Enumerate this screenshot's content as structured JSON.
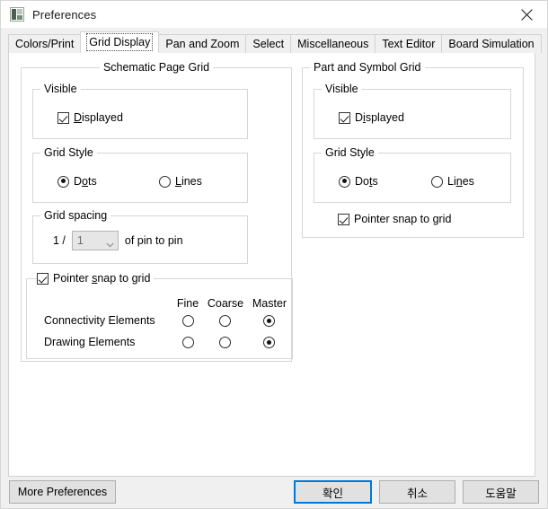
{
  "window": {
    "title": "Preferences",
    "icon": "app-icon",
    "close_icon": "close-icon"
  },
  "tabs": [
    {
      "label": "Colors/Print",
      "active": false
    },
    {
      "label": "Grid Display",
      "active": true
    },
    {
      "label": "Pan and Zoom",
      "active": false
    },
    {
      "label": "Select",
      "active": false
    },
    {
      "label": "Miscellaneous",
      "active": false
    },
    {
      "label": "Text Editor",
      "active": false
    },
    {
      "label": "Board Simulation",
      "active": false
    }
  ],
  "schematic_page_grid": {
    "legend": "Schematic Page Grid",
    "visible": {
      "legend": "Visible",
      "displayed": {
        "label_pre": "",
        "label_acc": "D",
        "label_post": "isplayed",
        "checked": true
      }
    },
    "grid_style": {
      "legend": "Grid Style",
      "dots": {
        "pre": "D",
        "acc": "o",
        "post": "ts",
        "selected": true
      },
      "lines": {
        "pre": "",
        "acc": "L",
        "post": "ines",
        "selected": false
      }
    },
    "grid_spacing": {
      "legend": "Grid spacing",
      "prefix": "1 /",
      "value": "1",
      "suffix": "of pin to pin",
      "options": [
        "1"
      ]
    },
    "snap": {
      "label_pre": "Pointer ",
      "label_acc": "s",
      "label_post": "nap to grid",
      "checked": true,
      "columns": [
        "Fine",
        "Coarse",
        "Master"
      ],
      "rows": [
        {
          "label": "Connectivity Elements",
          "selected": "Master"
        },
        {
          "label": "Drawing Elements",
          "selected": "Master"
        }
      ]
    }
  },
  "part_and_symbol_grid": {
    "legend": "Part and Symbol Grid",
    "visible": {
      "legend": "Visible",
      "displayed": {
        "label_pre": "D",
        "label_acc": "i",
        "label_post": "splayed",
        "checked": true
      }
    },
    "grid_style": {
      "legend": "Grid Style",
      "dots": {
        "pre": "Do",
        "acc": "t",
        "post": "s",
        "selected": true
      },
      "lines": {
        "pre": "Li",
        "acc": "n",
        "post": "es",
        "selected": false
      }
    },
    "snap": {
      "label_pre": "Pointer snap to ",
      "label_acc": "g",
      "label_post": "rid",
      "checked": true
    }
  },
  "footer": {
    "more_preferences": "More Preferences",
    "ok": "확인",
    "cancel": "취소",
    "help": "도움말"
  },
  "colors": {
    "accent": "#0078d7",
    "window_bg": "#f0f0f0",
    "pane_bg": "#ffffff",
    "border": "#d6d6d6",
    "button_bg": "#e1e1e1"
  }
}
